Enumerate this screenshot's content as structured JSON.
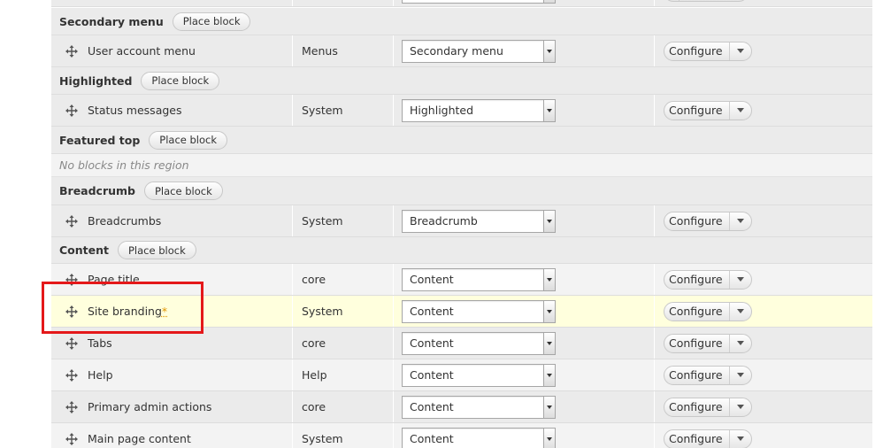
{
  "regions": {
    "secondary_menu": {
      "name": "Secondary menu",
      "place_block": "Place block"
    },
    "highlighted": {
      "name": "Highlighted",
      "place_block": "Place block"
    },
    "featured_top": {
      "name": "Featured top",
      "place_block": "Place block",
      "empty": "No blocks in this region"
    },
    "breadcrumb": {
      "name": "Breadcrumb",
      "place_block": "Place block"
    },
    "content": {
      "name": "Content",
      "place_block": "Place block"
    }
  },
  "blocks": [
    {
      "title": "User account menu",
      "category": "Menus",
      "region": "Secondary menu",
      "operation": "Configure"
    },
    {
      "title": "Status messages",
      "category": "System",
      "region": "Highlighted",
      "operation": "Configure"
    },
    {
      "title": "Breadcrumbs",
      "category": "System",
      "region": "Breadcrumb",
      "operation": "Configure"
    },
    {
      "title": "Page title",
      "category": "core",
      "region": "Content",
      "operation": "Configure"
    },
    {
      "title": "Site branding",
      "changed_marker": "*",
      "category": "System",
      "region": "Content",
      "operation": "Configure"
    },
    {
      "title": "Tabs",
      "category": "core",
      "region": "Content",
      "operation": "Configure"
    },
    {
      "title": "Help",
      "category": "Help",
      "region": "Content",
      "operation": "Configure"
    },
    {
      "title": "Primary admin actions",
      "category": "core",
      "region": "Content",
      "operation": "Configure"
    },
    {
      "title": "Main page content",
      "category": "System",
      "region": "Content",
      "operation": "Configure"
    }
  ],
  "icons": {
    "drag_handle": "move-arrows-icon",
    "select_arrow": "chevron-down-icon",
    "configure_dropdown": "caret-down-icon"
  },
  "colors": {
    "highlight_row": "#ffffdd",
    "annotation_box": "#e4181a",
    "changed_marker": "#e29700"
  }
}
